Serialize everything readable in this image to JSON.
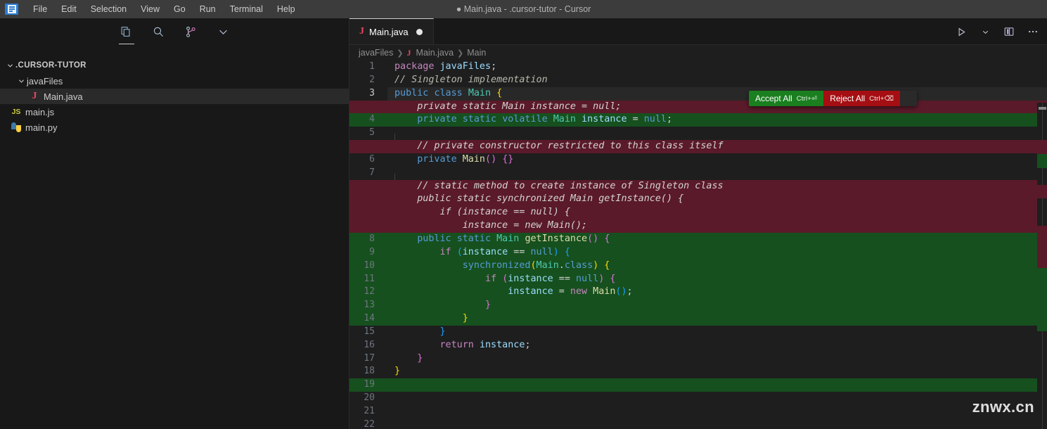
{
  "titlebar": {
    "window_title": "● Main.java - .cursor-tutor - Cursor",
    "logo_icon": "vscode-logo-icon",
    "menu": [
      {
        "label": "File"
      },
      {
        "label": "Edit"
      },
      {
        "label": "Selection"
      },
      {
        "label": "View"
      },
      {
        "label": "Go"
      },
      {
        "label": "Run"
      },
      {
        "label": "Terminal"
      },
      {
        "label": "Help"
      }
    ]
  },
  "activitybar": {
    "icons": [
      {
        "name": "explorer-icon",
        "active": true
      },
      {
        "name": "search-icon",
        "active": false
      },
      {
        "name": "source-control-icon",
        "active": false
      },
      {
        "name": "chevron-down-icon",
        "active": false
      }
    ]
  },
  "sidebar": {
    "root": {
      "label": ".CURSOR-TUTOR",
      "expanded": true
    },
    "items": [
      {
        "label": "javaFiles",
        "type": "folder",
        "expanded": true,
        "depth": 1,
        "icon": "chevron-down-icon",
        "selected": false
      },
      {
        "label": "Main.java",
        "type": "file",
        "depth": 2,
        "icon": "java-file-icon",
        "selected": true
      },
      {
        "label": "main.js",
        "type": "file",
        "depth": 1,
        "icon": "js-file-icon",
        "selected": false
      },
      {
        "label": "main.py",
        "type": "file",
        "depth": 1,
        "icon": "python-file-icon",
        "selected": false
      }
    ]
  },
  "editor": {
    "tab": {
      "label": "Main.java",
      "icon": "java-file-icon",
      "dirty": true
    },
    "tab_actions": [
      {
        "name": "run-button",
        "glyph": "▷"
      },
      {
        "name": "run-options-chevron-icon",
        "glyph": "⌄"
      },
      {
        "name": "split-editor-button",
        "glyph": "▯"
      },
      {
        "name": "more-actions-button",
        "glyph": "···"
      }
    ],
    "breadcrumbs": [
      {
        "label": "javaFiles"
      },
      {
        "label": "Main.java"
      },
      {
        "label": "Main"
      }
    ],
    "diff_widget": {
      "accept_label": "Accept All",
      "accept_shortcut": "Ctrl+⏎",
      "reject_label": "Reject All",
      "reject_shortcut": "Ctrl+⌫",
      "accept_color": "#1a7f1f",
      "reject_color": "#a50e12"
    },
    "diff_colors": {
      "added_background": "#16501e",
      "removed_background": "#5a1a29",
      "added_border": "#4a9e52",
      "removed_border": "#a03344"
    },
    "code_lines": [
      {
        "num": "1",
        "kind": "ctx",
        "text": "package javaFiles;"
      },
      {
        "num": "2",
        "kind": "ctx",
        "text": "// Singleton implementation"
      },
      {
        "num": "3",
        "kind": "cur",
        "text": "public class Main {"
      },
      {
        "num": "",
        "kind": "del",
        "text": "    private static Main instance = null;"
      },
      {
        "num": "4",
        "kind": "add",
        "text": "    private static volatile Main instance = null;"
      },
      {
        "num": "5",
        "kind": "ctx",
        "text": ""
      },
      {
        "num": "",
        "kind": "del",
        "text": "    // private constructor restricted to this class itself"
      },
      {
        "num": "6",
        "kind": "ctx",
        "text": "    private Main() {}"
      },
      {
        "num": "7",
        "kind": "ctx",
        "text": ""
      },
      {
        "num": "",
        "kind": "del",
        "text": "    // static method to create instance of Singleton class"
      },
      {
        "num": "",
        "kind": "del",
        "text": "    public static synchronized Main getInstance() {"
      },
      {
        "num": "",
        "kind": "del",
        "text": "        if (instance == null) {"
      },
      {
        "num": "",
        "kind": "del",
        "text": "            instance = new Main();"
      },
      {
        "num": "8",
        "kind": "add",
        "text": "    public static Main getInstance() {"
      },
      {
        "num": "9",
        "kind": "add",
        "text": "        if (instance == null) {"
      },
      {
        "num": "10",
        "kind": "add",
        "text": "            synchronized(Main.class) {"
      },
      {
        "num": "11",
        "kind": "add",
        "text": "                if (instance == null) {"
      },
      {
        "num": "12",
        "kind": "add",
        "text": "                    instance = new Main();"
      },
      {
        "num": "13",
        "kind": "add",
        "text": "                }"
      },
      {
        "num": "14",
        "kind": "add",
        "text": "            }"
      },
      {
        "num": "15",
        "kind": "ctx",
        "text": "        }"
      },
      {
        "num": "16",
        "kind": "ctx",
        "text": "        return instance;"
      },
      {
        "num": "17",
        "kind": "ctx",
        "text": "    }"
      },
      {
        "num": "18",
        "kind": "ctx",
        "text": "}"
      },
      {
        "num": "19",
        "kind": "add",
        "text": ""
      },
      {
        "num": "20",
        "kind": "ctx",
        "text": ""
      },
      {
        "num": "21",
        "kind": "ctx",
        "text": ""
      },
      {
        "num": "22",
        "kind": "ctx",
        "text": ""
      }
    ]
  },
  "watermark": {
    "text": "znwx.cn"
  }
}
